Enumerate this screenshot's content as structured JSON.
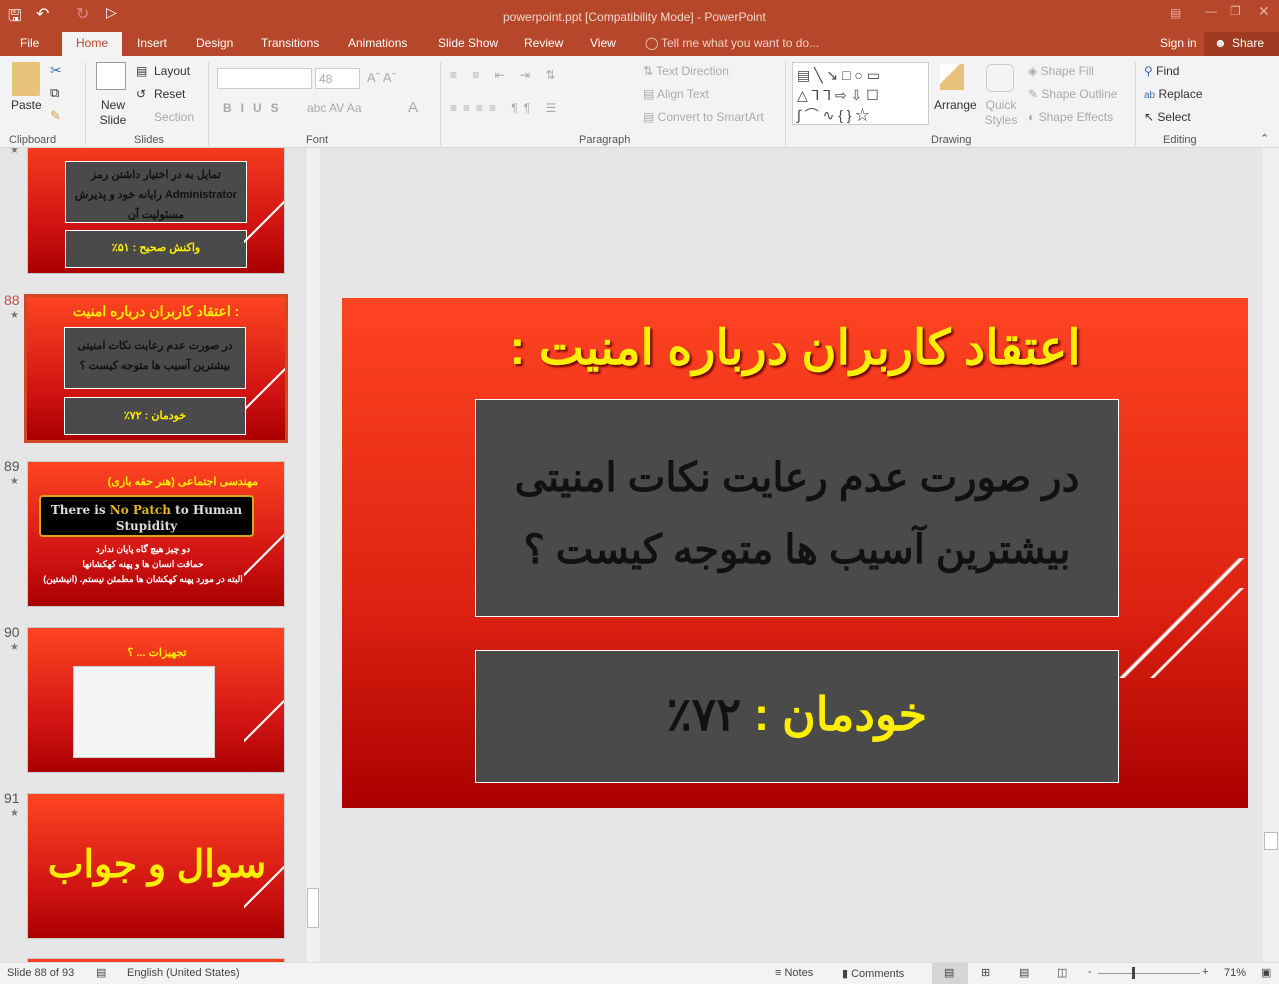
{
  "window": {
    "title": "powerpoint.ppt [Compatibility Mode] - PowerPoint"
  },
  "tabs": [
    "File",
    "Home",
    "Insert",
    "Design",
    "Transitions",
    "Animations",
    "Slide Show",
    "Review",
    "View"
  ],
  "tell_me": "Tell me what you want to do...",
  "sign_in": "Sign in",
  "share": "Share",
  "ribbon": {
    "paste": "Paste",
    "new_slide": "New Slide",
    "layout": "Layout",
    "reset": "Reset",
    "section": "Section",
    "font_name": "",
    "font_size": "48",
    "text_direction": "Text Direction",
    "align_text": "Align Text",
    "convert_smartart": "Convert to SmartArt",
    "arrange": "Arrange",
    "quick_styles": "Quick Styles",
    "shape_fill": "Shape Fill",
    "shape_outline": "Shape Outline",
    "shape_effects": "Shape Effects",
    "find": "Find",
    "replace": "Replace",
    "select": "Select",
    "groups": {
      "clipboard": "Clipboard",
      "slides": "Slides",
      "font": "Font",
      "paragraph": "Paragraph",
      "drawing": "Drawing",
      "editing": "Editing"
    }
  },
  "thumbnails": [
    {
      "num": "",
      "box1": "تمایل به در اختیار داشتن رمز Administrator رایانه خود و پذیرش مسئولیت آن",
      "box2": "واکنش صحیح : ۵۱٪"
    },
    {
      "num": "88",
      "title": "اعتقاد کاربران درباره امنیت :",
      "box1": "در صورت عدم رعایت نکات امنیتی بیشترین آسیب ها متوجه کیست ؟",
      "box2": "خودمان : ۷۲٪"
    },
    {
      "num": "89",
      "title": "مهندسی اجتماعی (هنر حقه بازی)",
      "banner_a": "There is ",
      "banner_b": "No Patch",
      "banner_c": " to Human Stupidity",
      "l1": "دو چیز هیچ گاه پایان ندارد",
      "l2": "حماقت انسان ها و پهنه کهکشانها",
      "l3": "البته در مورد پهنه کهکشان ها مطمئن نیستم. (انیشتین)"
    },
    {
      "num": "90",
      "title": "تجهیزات ... ؟"
    },
    {
      "num": "91",
      "title": "سوال و جواب"
    }
  ],
  "slide": {
    "title": "اعتقاد کاربران درباره امنیت :",
    "question": "در صورت عدم رعایت نکات امنیتی بیشترین آسیب ها متوجه کیست ؟",
    "answer_label": "خودمان :",
    "answer_value": "۷۲٪"
  },
  "status": {
    "slide": "Slide 88 of 93",
    "language": "English (United States)",
    "notes": "Notes",
    "comments": "Comments",
    "zoom": "71%",
    "zoom_level": 71
  }
}
